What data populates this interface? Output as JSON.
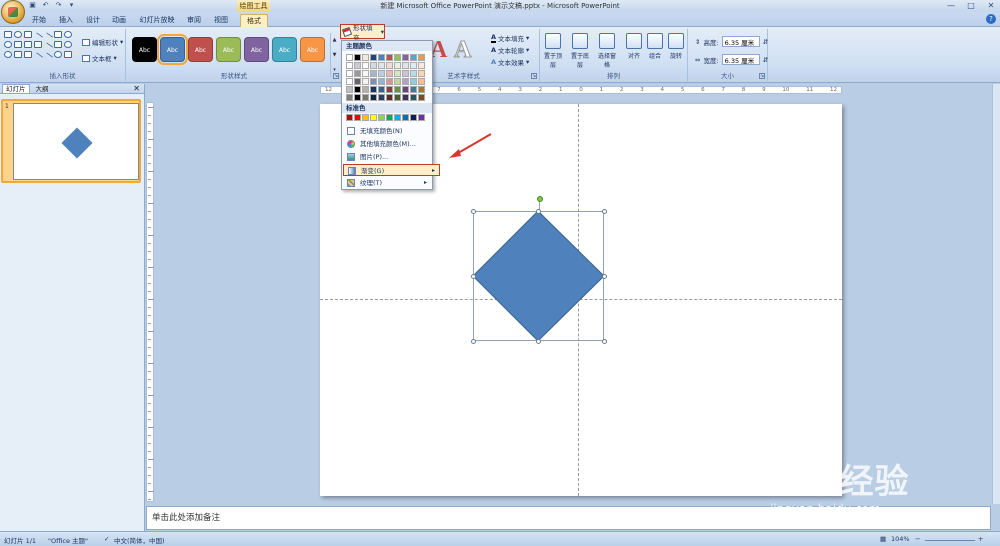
{
  "window": {
    "title": "新建 Microsoft Office PowerPoint 演示文稿.pptx - Microsoft PowerPoint",
    "context_tab_title": "绘图工具",
    "controls": [
      "—",
      "□",
      "✕"
    ]
  },
  "tabs": [
    "开始",
    "插入",
    "设计",
    "动画",
    "幻灯片放映",
    "审阅",
    "视图",
    "格式"
  ],
  "active_tab": "格式",
  "ribbon": {
    "insert_shapes": {
      "label": "插入形状",
      "edit_shape": "编辑形状",
      "text_box": "文本框"
    },
    "shape_styles": {
      "label": "形状样式",
      "styles": [
        {
          "text": "Abc",
          "color": "#000000"
        },
        {
          "text": "Abc",
          "color": "#4f81bd"
        },
        {
          "text": "Abc",
          "color": "#c0504d"
        },
        {
          "text": "Abc",
          "color": "#9bbb59"
        },
        {
          "text": "Abc",
          "color": "#8064a2"
        },
        {
          "text": "Abc",
          "color": "#4bacc6"
        },
        {
          "text": "Abc",
          "color": "#f79646"
        }
      ],
      "shape_fill": "形状填充"
    },
    "wordart": {
      "label": "艺术字样式",
      "text_fill": "文本填充",
      "text_outline": "文本轮廓",
      "text_effects": "文本效果"
    },
    "arrange": {
      "label": "排列",
      "buttons": [
        "置于顶层",
        "置于底层",
        "选择窗格",
        "对齐",
        "组合",
        "旋转"
      ]
    },
    "size": {
      "label": "大小",
      "height_label": "高度:",
      "height_value": "6.35 厘米",
      "width_label": "宽度:",
      "width_value": "6.35 厘米"
    }
  },
  "left_panel": {
    "tab_slides": "幻灯片",
    "tab_outline": "大纲",
    "close": "✕",
    "slide_number": "1"
  },
  "ruler_labels": [
    "12",
    "11",
    "10",
    "9",
    "8",
    "7",
    "6",
    "5",
    "4",
    "3",
    "2",
    "1",
    "0",
    "1",
    "2",
    "3",
    "4",
    "5",
    "6",
    "7",
    "8",
    "9",
    "10",
    "11",
    "12"
  ],
  "notes_placeholder": "单击此处添加备注",
  "status": {
    "slide": "幻灯片 1/1",
    "theme": "\"Office 主题\"",
    "language": "中文(简体，中国)",
    "zoom": "104%"
  },
  "fill_menu": {
    "theme_colors_label": "主题颜色",
    "standard_colors_label": "标准色",
    "theme_top_row": [
      "#ffffff",
      "#000000",
      "#eeece1",
      "#1f497d",
      "#4f81bd",
      "#c0504d",
      "#9bbb59",
      "#8064a2",
      "#4bacc6",
      "#f79646"
    ],
    "standard_colors": [
      "#c00000",
      "#ff0000",
      "#ffc000",
      "#ffff00",
      "#92d050",
      "#00b050",
      "#00b0f0",
      "#0070c0",
      "#002060",
      "#7030a0"
    ],
    "items": [
      {
        "label": "无填充颜色(N)",
        "icon": "no-fill-icon",
        "submenu": false
      },
      {
        "label": "其他填充颜色(M)...",
        "icon": "color-wheel-icon",
        "submenu": false
      },
      {
        "label": "图片(P)...",
        "icon": "picture-icon",
        "submenu": false
      },
      {
        "label": "渐变(G)",
        "icon": "gradient-icon",
        "submenu": true
      },
      {
        "label": "纹理(T)",
        "icon": "texture-icon",
        "submenu": true
      }
    ]
  },
  "watermark": {
    "logo": "Baidu经验",
    "url": "jingyan.baidu.com"
  },
  "shape": {
    "fill": "#4f81bd",
    "stroke": "#3a6190"
  }
}
